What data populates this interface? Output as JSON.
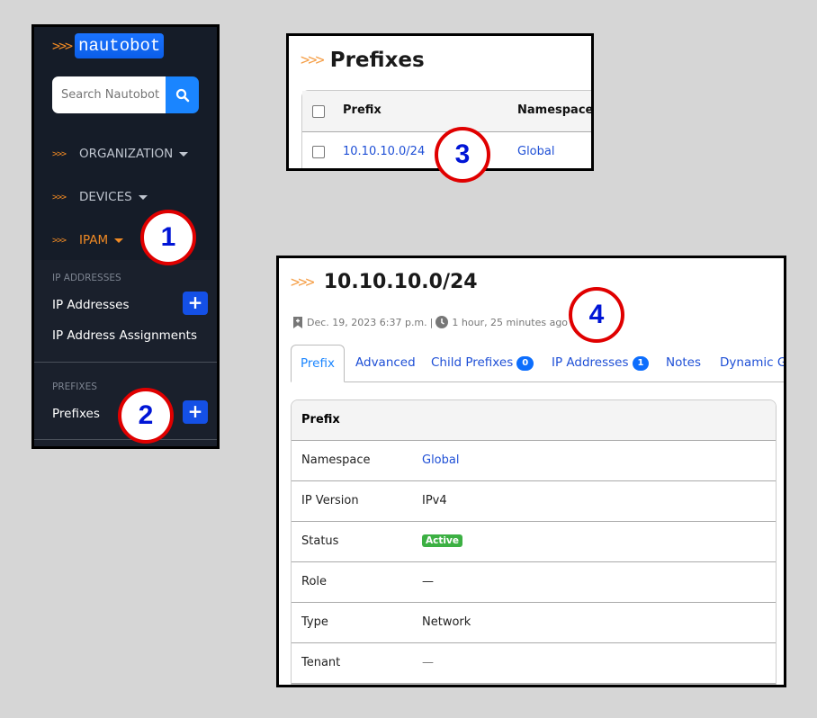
{
  "sidebar": {
    "logo_chevrons": ">>>",
    "logo_text": "nautobot",
    "search_placeholder": "Search Nautobot",
    "search_icon": "search-icon",
    "groups": [
      {
        "chevrons": ">>>",
        "label": "ORGANIZATION"
      },
      {
        "chevrons": ">>>",
        "label": "DEVICES"
      },
      {
        "chevrons": ">>>",
        "label": "IPAM"
      }
    ],
    "sections": [
      {
        "heading": "IP ADDRESSES",
        "items": [
          "IP Addresses",
          "IP Address Assignments"
        ]
      },
      {
        "heading": "PREFIXES",
        "items": [
          "Prefixes"
        ]
      }
    ],
    "plus_label": "+"
  },
  "prefix_list": {
    "chevrons": ">>>",
    "title": "Prefixes",
    "columns": [
      "Prefix",
      "Namespace"
    ],
    "rows": [
      {
        "prefix": "10.10.10.0/24",
        "namespace": "Global"
      }
    ]
  },
  "prefix_detail": {
    "chevrons": ">>>",
    "title": "10.10.10.0/24",
    "created": "Dec. 19, 2023 6:37 p.m.",
    "separator": "|",
    "updated": "1 hour, 25 minutes ago",
    "tabs": [
      {
        "label": "Prefix"
      },
      {
        "label": "Advanced"
      },
      {
        "label": "Child Prefixes",
        "badge": "0"
      },
      {
        "label": "IP Addresses",
        "badge": "1"
      },
      {
        "label": "Notes"
      },
      {
        "label": "Dynamic Gr"
      }
    ],
    "card_title": "Prefix",
    "fields": [
      {
        "key": "Namespace",
        "value": "Global"
      },
      {
        "key": "IP Version",
        "value": "IPv4"
      },
      {
        "key": "Status",
        "value": "Active"
      },
      {
        "key": "Role",
        "value": "—"
      },
      {
        "key": "Type",
        "value": "Network"
      },
      {
        "key": "Tenant",
        "value": "—"
      }
    ]
  },
  "callouts": [
    "1",
    "2",
    "3",
    "4"
  ],
  "colors": {
    "accent": "#f08a24",
    "link": "#1e4fd6",
    "status_active": "#3cb043",
    "callout_border": "#e00000",
    "callout_text": "#0015d6"
  }
}
